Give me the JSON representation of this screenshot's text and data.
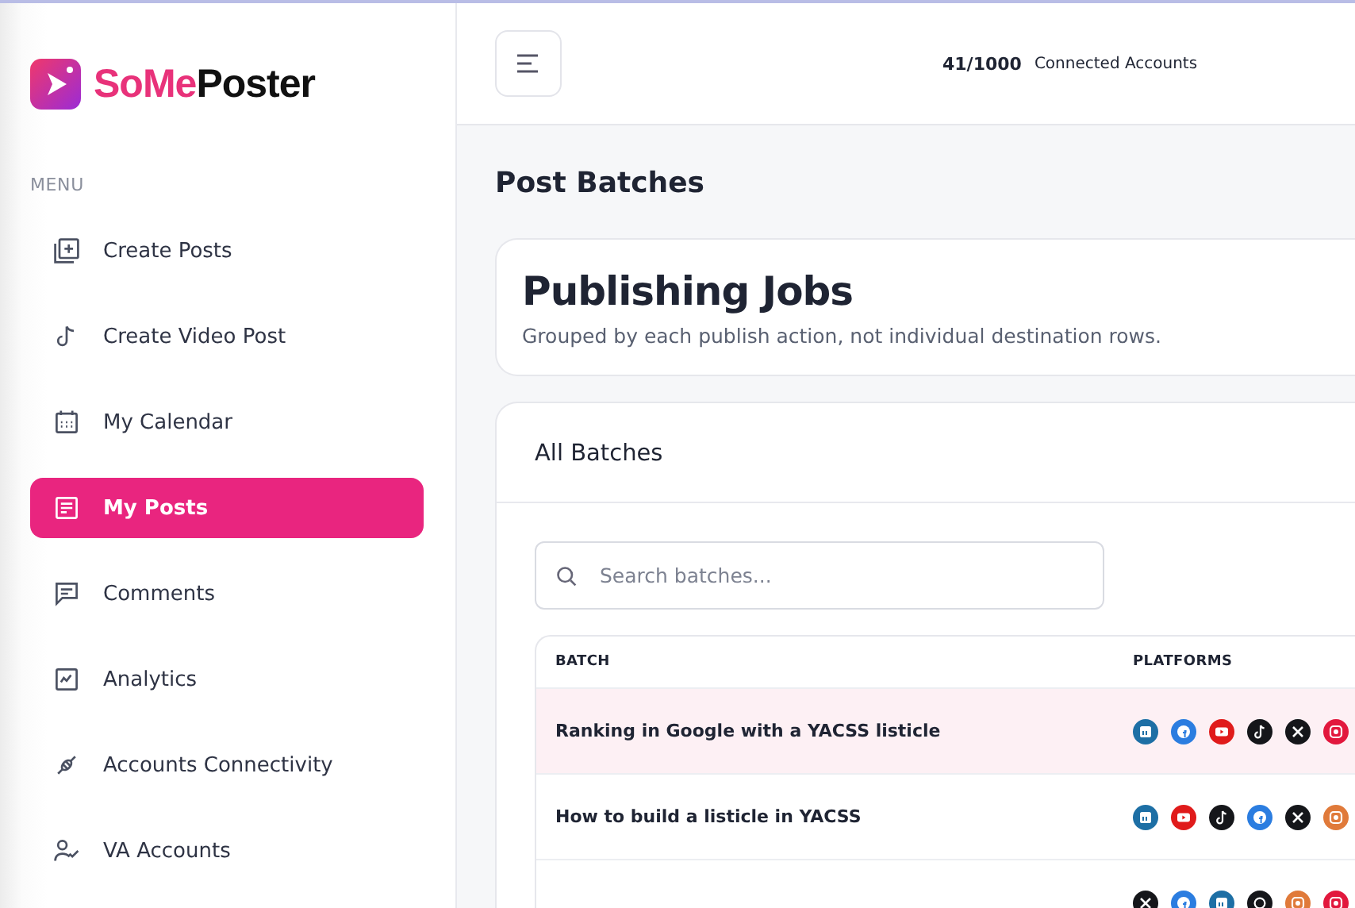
{
  "brand": {
    "name_part_1": "SoMe",
    "name_part_2": "Poster"
  },
  "sidebar": {
    "heading": "MENU",
    "items": [
      {
        "label": "Create Posts",
        "kind": "add",
        "selected": false
      },
      {
        "label": "Create Video Post",
        "kind": "note",
        "selected": false
      },
      {
        "label": "My Calendar",
        "kind": "calendar",
        "selected": false
      },
      {
        "label": "My Posts",
        "kind": "list",
        "selected": true
      },
      {
        "label": "Comments",
        "kind": "comment",
        "selected": false
      },
      {
        "label": "Analytics",
        "kind": "chart",
        "selected": false
      },
      {
        "label": "Accounts Connectivity",
        "kind": "plug",
        "selected": false
      },
      {
        "label": "VA Accounts",
        "kind": "user",
        "selected": false
      }
    ]
  },
  "header": {
    "count": "41/1000",
    "count_label": "Connected Accounts"
  },
  "page_title": "Post Batches",
  "intro": {
    "title": "Publishing Jobs",
    "subtitle": "Grouped by each publish action, not individual destination rows."
  },
  "batches": {
    "title": "All Batches",
    "search": {
      "placeholder": "Search batches..."
    },
    "columns": [
      "BATCH",
      "PLATFORMS"
    ],
    "rows": [
      {
        "batch": "Ranking in Google with a YACSS listicle",
        "highlighted": true,
        "platforms": [
          {
            "kind": "linkedin"
          },
          {
            "kind": "facebook"
          },
          {
            "kind": "youtube"
          },
          {
            "kind": "tiktok"
          },
          {
            "kind": "x"
          },
          {
            "kind": "pinterest"
          }
        ]
      },
      {
        "batch": "How to build a listicle in YACSS",
        "highlighted": false,
        "platforms": [
          {
            "kind": "linkedin"
          },
          {
            "kind": "youtube"
          },
          {
            "kind": "tiktok"
          },
          {
            "kind": "facebook"
          },
          {
            "kind": "x"
          },
          {
            "kind": "instagram"
          }
        ]
      },
      {
        "highlighted": false,
        "platforms": [
          {
            "kind": "x"
          },
          {
            "kind": "facebook"
          },
          {
            "kind": "linkedin"
          },
          {
            "kind": "threads"
          },
          {
            "kind": "instagram"
          },
          {
            "kind": "pinterest"
          }
        ]
      }
    ]
  }
}
